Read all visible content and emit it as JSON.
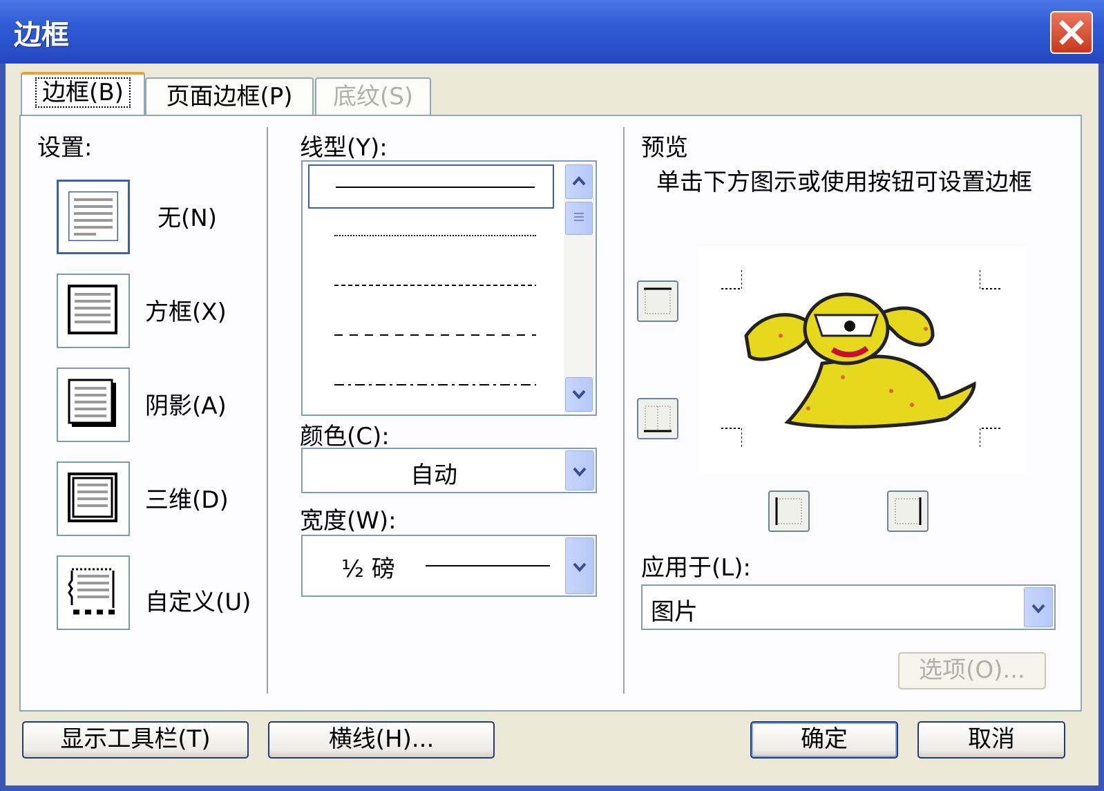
{
  "window": {
    "title": "边框"
  },
  "tabs": [
    {
      "label": "边框(B)",
      "state": "active"
    },
    {
      "label": "页面边框(P)",
      "state": "normal"
    },
    {
      "label": "底纹(S)",
      "state": "disabled"
    }
  ],
  "settings": {
    "heading": "设置:",
    "items": [
      {
        "label": "无(N)",
        "icon": "setting-none-icon"
      },
      {
        "label": "方框(X)",
        "icon": "setting-box-icon"
      },
      {
        "label": "阴影(A)",
        "icon": "setting-shadow-icon"
      },
      {
        "label": "三维(D)",
        "icon": "setting-3d-icon"
      },
      {
        "label": "自定义(U)",
        "icon": "setting-custom-icon"
      }
    ],
    "selected_index": 0
  },
  "style": {
    "heading": "线型(Y):",
    "line_styles": [
      "solid",
      "dotted",
      "dashed-fine",
      "dashed",
      "dash-dot"
    ],
    "selected_index": 0
  },
  "color": {
    "heading": "颜色(C):",
    "value": "自动"
  },
  "width": {
    "heading": "宽度(W):",
    "value": "½ 磅"
  },
  "preview": {
    "heading": "预览",
    "hint": "单击下方图示或使用按钮可设置边框",
    "image": "dog-clipart"
  },
  "apply_to": {
    "heading": "应用于(L):",
    "value": "图片"
  },
  "options_button": "选项(O)...",
  "footer": {
    "toolbar_button": "显示工具栏(T)",
    "horizontal_line_button": "横线(H)...",
    "ok_button": "确定",
    "cancel_button": "取消"
  },
  "colors": {
    "title_bar": "#2f5bd6",
    "close": "#c8391c",
    "dialog": "#ece9d8"
  }
}
